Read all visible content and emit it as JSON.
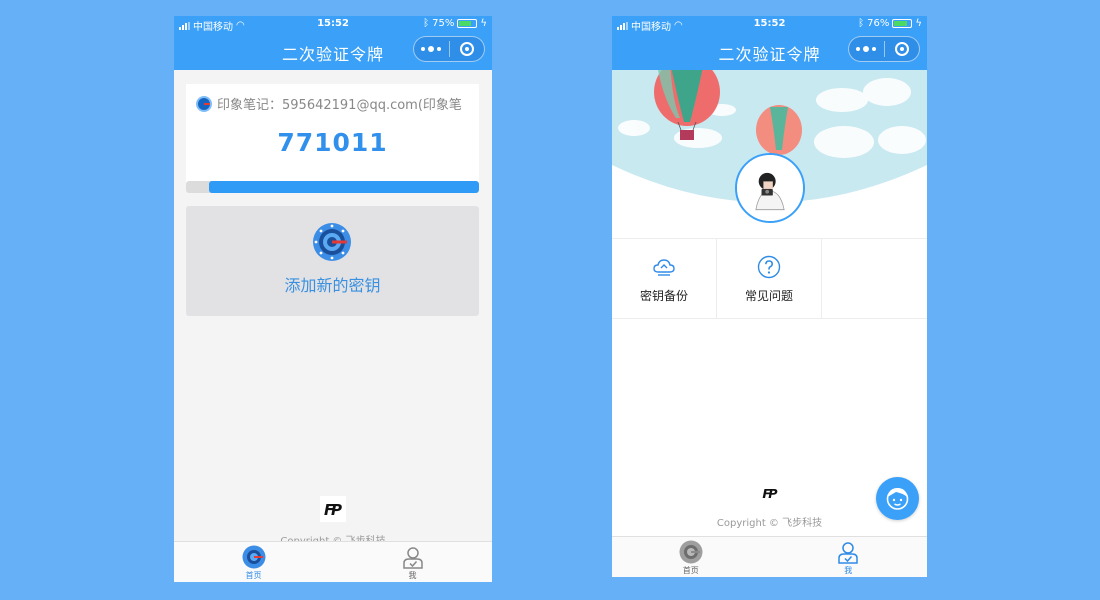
{
  "screen_left": {
    "status": {
      "carrier": "中国移动",
      "time": "15:52",
      "battery": "75%",
      "battery_level": 0.75
    },
    "nav": {
      "title": "二次验证令牌"
    },
    "account": {
      "name": "印象笔记：595642191@qq.com(印象笔",
      "code": "771011",
      "remaining_fraction": 0.92
    },
    "add_key": {
      "label": "添加新的密钥"
    },
    "footer": {
      "copyright": "Copyright © 飞步科技"
    },
    "tabs": [
      {
        "label": "首页",
        "icon": "authenticator-icon",
        "active": true
      },
      {
        "label": "我",
        "icon": "user-icon",
        "active": false
      }
    ]
  },
  "screen_right": {
    "status": {
      "carrier": "中国移动",
      "time": "15:52",
      "battery": "76%",
      "battery_level": 0.76
    },
    "nav": {
      "title": "二次验证令牌"
    },
    "menu": [
      {
        "label": "密钥备份",
        "icon": "cloud-backup-icon"
      },
      {
        "label": "常见问题",
        "icon": "question-circle-icon"
      }
    ],
    "footer": {
      "copyright": "Copyright © 飞步科技"
    },
    "tabs": [
      {
        "label": "首页",
        "icon": "authenticator-icon",
        "active": false
      },
      {
        "label": "我",
        "icon": "user-icon",
        "active": true
      }
    ]
  },
  "colors": {
    "primary": "#3aa0f8",
    "code": "#3290ed",
    "page_bg": "#66b0f8"
  }
}
